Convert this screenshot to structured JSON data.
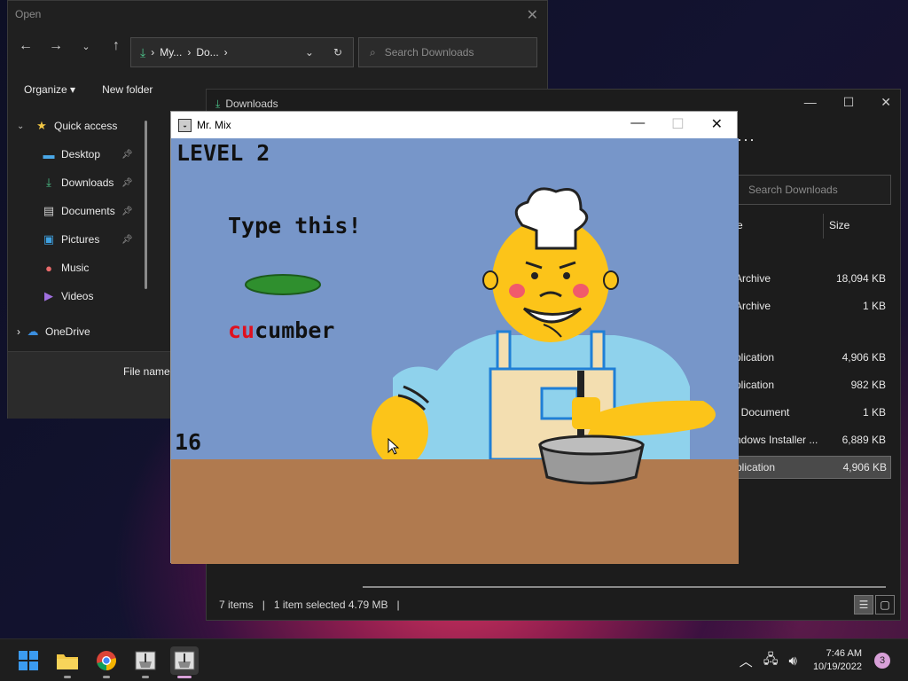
{
  "open_dialog": {
    "title": "Open",
    "breadcrumb": [
      "My...",
      "Do..."
    ],
    "search_placeholder": "Search Downloads",
    "toolbar": {
      "organize": "Organize",
      "new_folder": "New folder"
    },
    "nav_items": [
      {
        "label": "Quick access",
        "icon": "star-icon"
      },
      {
        "label": "Desktop",
        "icon": "desktop-icon",
        "pinned": true
      },
      {
        "label": "Downloads",
        "icon": "download-icon",
        "pinned": true
      },
      {
        "label": "Documents",
        "icon": "documents-icon",
        "pinned": true
      },
      {
        "label": "Pictures",
        "icon": "pictures-icon",
        "pinned": true
      },
      {
        "label": "Music",
        "icon": "music-icon"
      },
      {
        "label": "Videos",
        "icon": "videos-icon"
      },
      {
        "label": "OneDrive",
        "icon": "cloud-icon"
      }
    ],
    "file_name_label": "File name:"
  },
  "downloads_window": {
    "title": "Downloads",
    "search_placeholder": "Search Downloads",
    "columns": {
      "type": "e",
      "size": "Size"
    },
    "files": [
      {
        "type": "Archive",
        "size": "18,094 KB"
      },
      {
        "type": "Archive",
        "size": "1 KB"
      },
      {
        "type": "plication",
        "size": "4,906 KB"
      },
      {
        "type": "plication",
        "size": "982 KB"
      },
      {
        "type": "t Document",
        "size": "1 KB"
      },
      {
        "type": "ndows Installer ...",
        "size": "6,889 KB"
      },
      {
        "type": "plication",
        "size": "4,906 KB",
        "selected": true
      }
    ],
    "status": {
      "items": "7 items",
      "selected": "1 item selected  4.79 MB"
    }
  },
  "game_window": {
    "title": "Mr. Mix",
    "level": "LEVEL 2",
    "prompt": "Type this!",
    "word_typed": "cu",
    "word_rest": "cumber",
    "score": "16",
    "colors": {
      "sky": "#7796c9",
      "counter": "#b07a4f",
      "face": "#fcc419",
      "apron": "#f3deb0",
      "shirt": "#8fd2ec"
    }
  },
  "taskbar": {
    "time": "7:46 AM",
    "date": "10/19/2022",
    "notification_count": "3"
  }
}
